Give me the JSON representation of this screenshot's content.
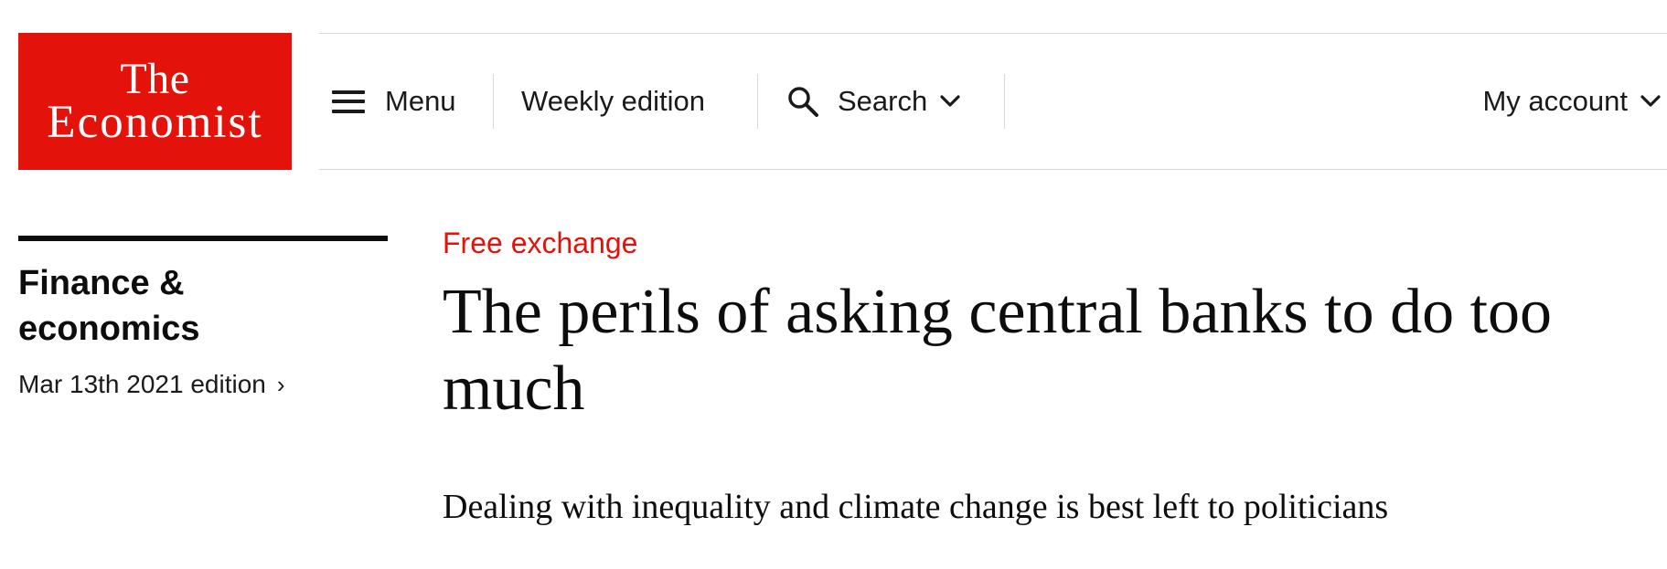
{
  "brand": {
    "line1": "The",
    "line2": "Economist",
    "color": "#e3120b"
  },
  "nav": {
    "menu_label": "Menu",
    "weekly_label": "Weekly edition",
    "search_label": "Search",
    "account_label": "My account",
    "icons": {
      "menu": "hamburger-icon",
      "search": "search-icon",
      "dropdown": "chevron-down-icon"
    }
  },
  "sidebar": {
    "section_title": "Finance & economics",
    "edition_label": "Mar 13th 2021 edition",
    "edition_arrow": "›"
  },
  "article": {
    "flytitle": "Free exchange",
    "headline": "The perils of asking central banks to do too much",
    "rubric": "Dealing with inequality and climate change is best left to politicians"
  },
  "colors": {
    "accent_red": "#e3120b",
    "text": "#0d0d0d",
    "divider": "#d7d7d7"
  }
}
